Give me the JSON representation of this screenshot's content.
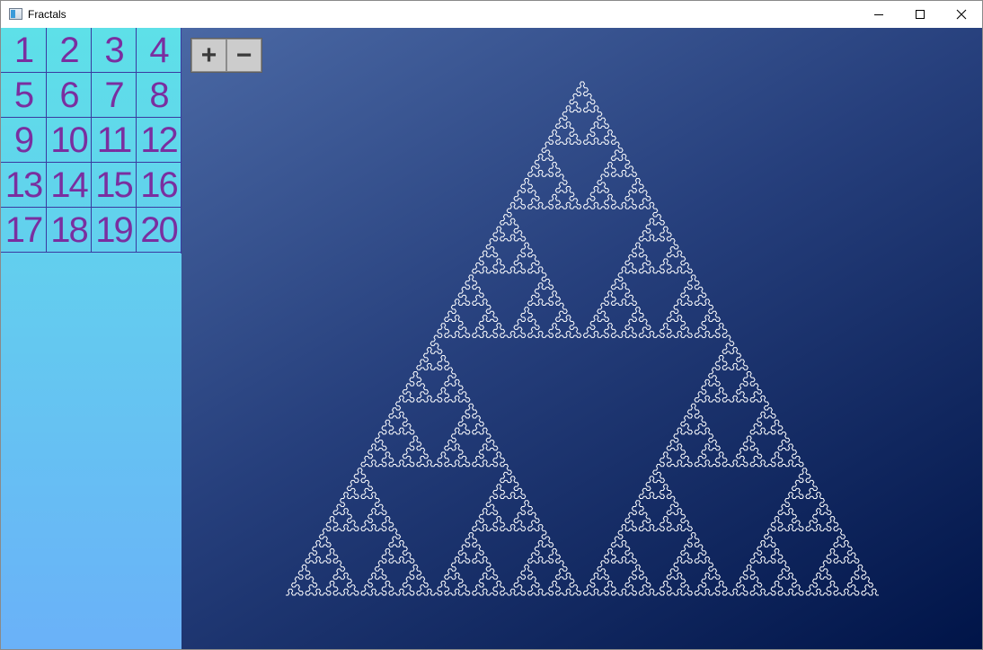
{
  "window": {
    "title": "Fractals"
  },
  "sidebar": {
    "levels": [
      "1",
      "2",
      "3",
      "4",
      "5",
      "6",
      "7",
      "8",
      "9",
      "10",
      "11",
      "12",
      "13",
      "14",
      "15",
      "16",
      "17",
      "18",
      "19",
      "20"
    ]
  },
  "toolbar": {
    "zoom_in_label": "+",
    "zoom_out_label": "−"
  },
  "fractal": {
    "type": "sierpinski-arrowhead-curve",
    "order": 8,
    "stroke_color": "#ffffff"
  },
  "colors": {
    "sidebar_top": "#5ee0e8",
    "sidebar_bottom": "#6ab1f8",
    "canvas_top": "#4a68a4",
    "canvas_bottom": "#001448",
    "cell_text": "#7a2ea0",
    "grid_line": "#3a3aa0"
  }
}
